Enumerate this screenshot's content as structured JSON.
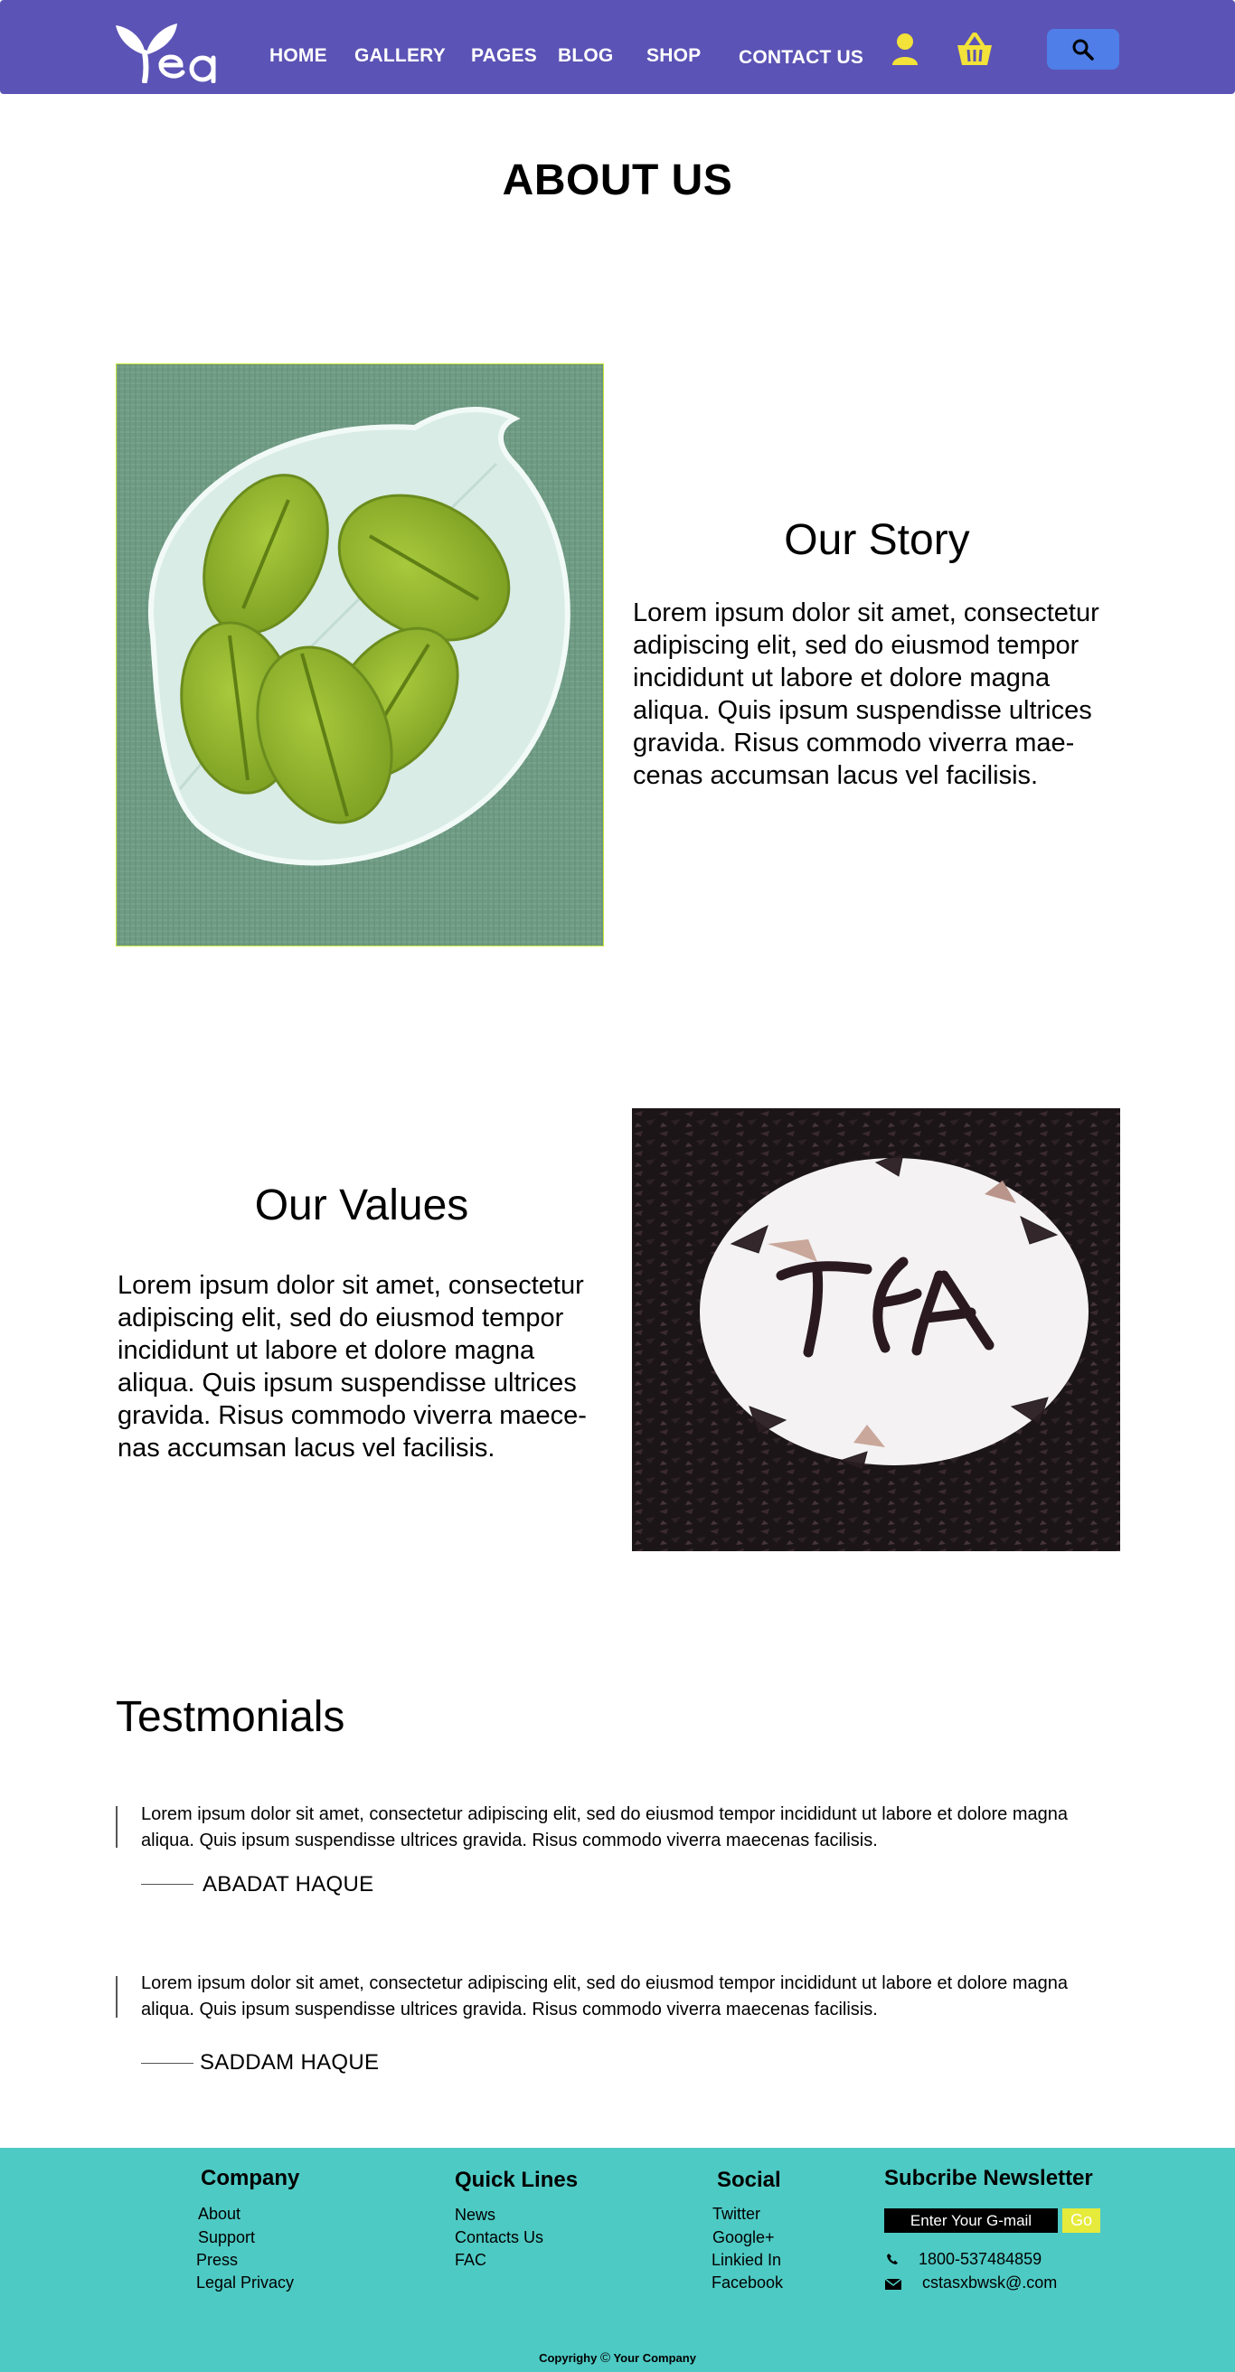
{
  "header": {
    "logo_text": "Tea",
    "nav": [
      "HOME",
      "GALLERY",
      "PAGES",
      "BLOG",
      "SHOP",
      "CONTACT US"
    ],
    "icons": {
      "user": "user-icon",
      "cart": "basket-icon",
      "search": "search-icon"
    },
    "colors": {
      "bar": "#5b53b5",
      "icons": "#f2e23a",
      "search_button": "#4f7ee8"
    }
  },
  "page_title": "ABOUT US",
  "story": {
    "heading": "Our Story",
    "body": "Lorem ipsum dolor sit amet, consectetur adipiscing elit, sed do eiusmod tempor incididunt ut labore et dolore magna aliqua. Quis ipsum suspendisse ultrices gravida. Risus commodo viverra mae-cenas accumsan lacus vel facilisis."
  },
  "values": {
    "heading": "Our Values",
    "body": "Lorem ipsum dolor sit amet, consectetur adipiscing elit, sed do eiusmod tempor incididunt ut labore et dolore magna aliqua. Quis ipsum suspendisse ultrices gravida. Risus commodo viverra maece-nas accumsan lacus vel facilisis.",
    "image_text": "TEA"
  },
  "testimonials": {
    "heading": "Testmonials",
    "items": [
      {
        "text": "Lorem ipsum dolor sit amet, consectetur adipiscing elit, sed do eiusmod tempor incididunt ut labore et dolore magna aliqua. Quis ipsum suspendisse ultrices gravida. Risus commodo viverra maecenas facilisis.",
        "name": "ABADAT HAQUE"
      },
      {
        "text": "Lorem ipsum dolor sit amet, consectetur adipiscing elit, sed do eiusmod tempor incididunt ut labore et dolore magna aliqua. Quis ipsum suspendisse ultrices gravida. Risus commodo viverra maecenas facilisis.",
        "name": "SADDAM HAQUE"
      }
    ]
  },
  "footer": {
    "company": {
      "heading": "Company",
      "links": [
        "About",
        "Support",
        "Press",
        "Legal Privacy"
      ]
    },
    "quick": {
      "heading": "Quick Lines",
      "links": [
        "News",
        "Contacts Us",
        "FAC"
      ]
    },
    "social": {
      "heading": "Social",
      "links": [
        "Twitter",
        "Google+",
        "Linkied In",
        "Facebook"
      ]
    },
    "newsletter": {
      "heading": "Subcribe Newsletter",
      "placeholder": "Enter Your G-mail",
      "button": "Go",
      "phone": "1800-537484859",
      "email": "cstasxbwsk@.com"
    },
    "copyright_left": "Copyrighy",
    "copyright_symbol": "©",
    "copyright_right": "Your Company",
    "colors": {
      "background": "#4ecac4",
      "go_button": "#e6ea3a"
    }
  }
}
